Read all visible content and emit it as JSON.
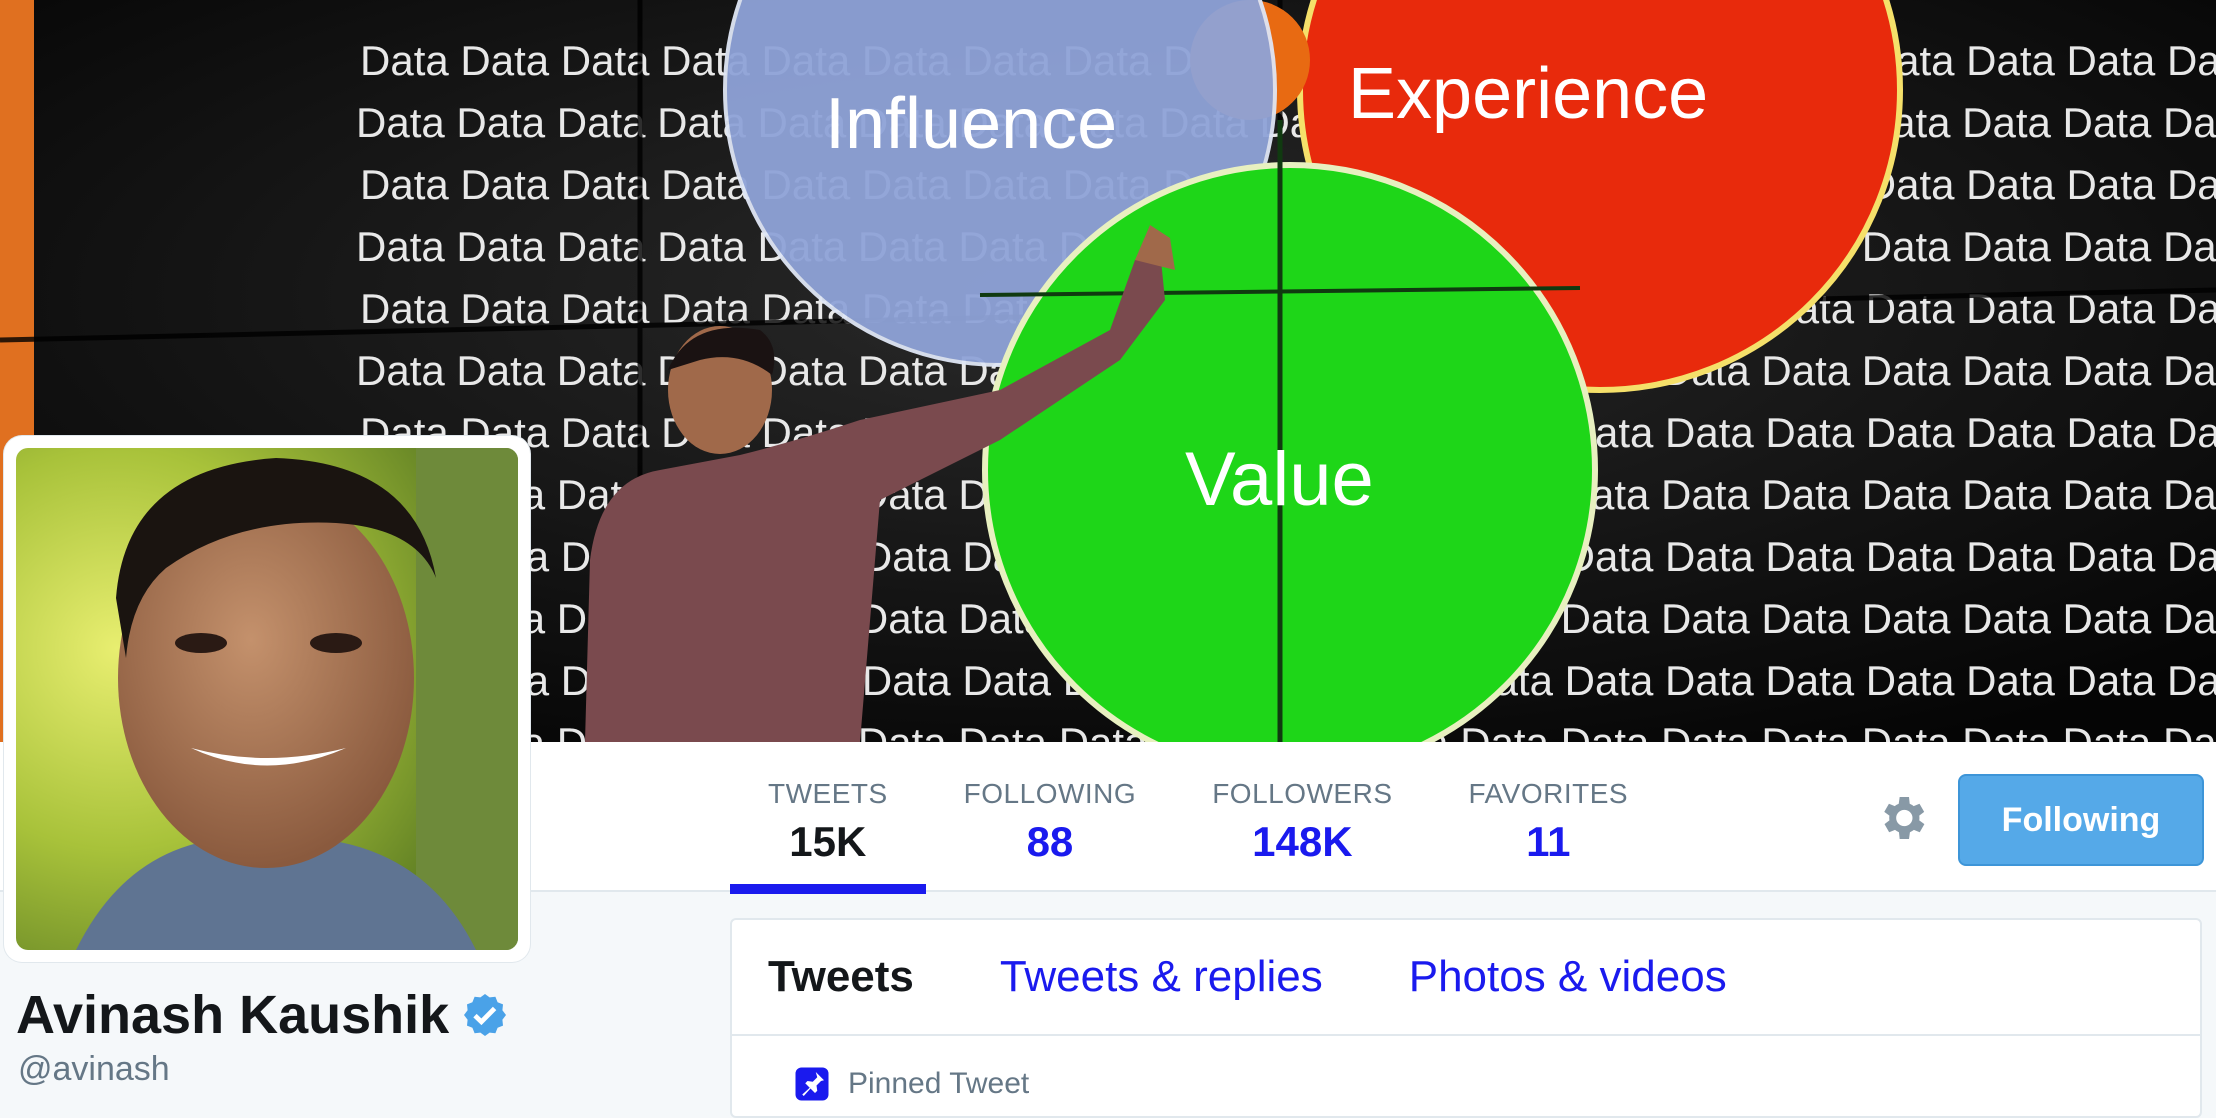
{
  "banner": {
    "venn": [
      "Influence",
      "Experience",
      "Value"
    ],
    "wall_word": "Data"
  },
  "stats": [
    {
      "label": "TWEETS",
      "value": "15K"
    },
    {
      "label": "FOLLOWING",
      "value": "88"
    },
    {
      "label": "FOLLOWERS",
      "value": "148K"
    },
    {
      "label": "FAVORITES",
      "value": "11"
    }
  ],
  "actions": {
    "follow_label": "Following"
  },
  "profile": {
    "name": "Avinash Kaushik",
    "handle": "@avinash"
  },
  "tabs": [
    "Tweets",
    "Tweets & replies",
    "Photos & videos"
  ],
  "pinned": {
    "label": "Pinned Tweet"
  },
  "colors": {
    "accent": "#1a1aee",
    "button": "#55a9e8",
    "muted": "#657786"
  },
  "icons": [
    "gear-icon",
    "verified-badge-icon",
    "pin-icon"
  ]
}
